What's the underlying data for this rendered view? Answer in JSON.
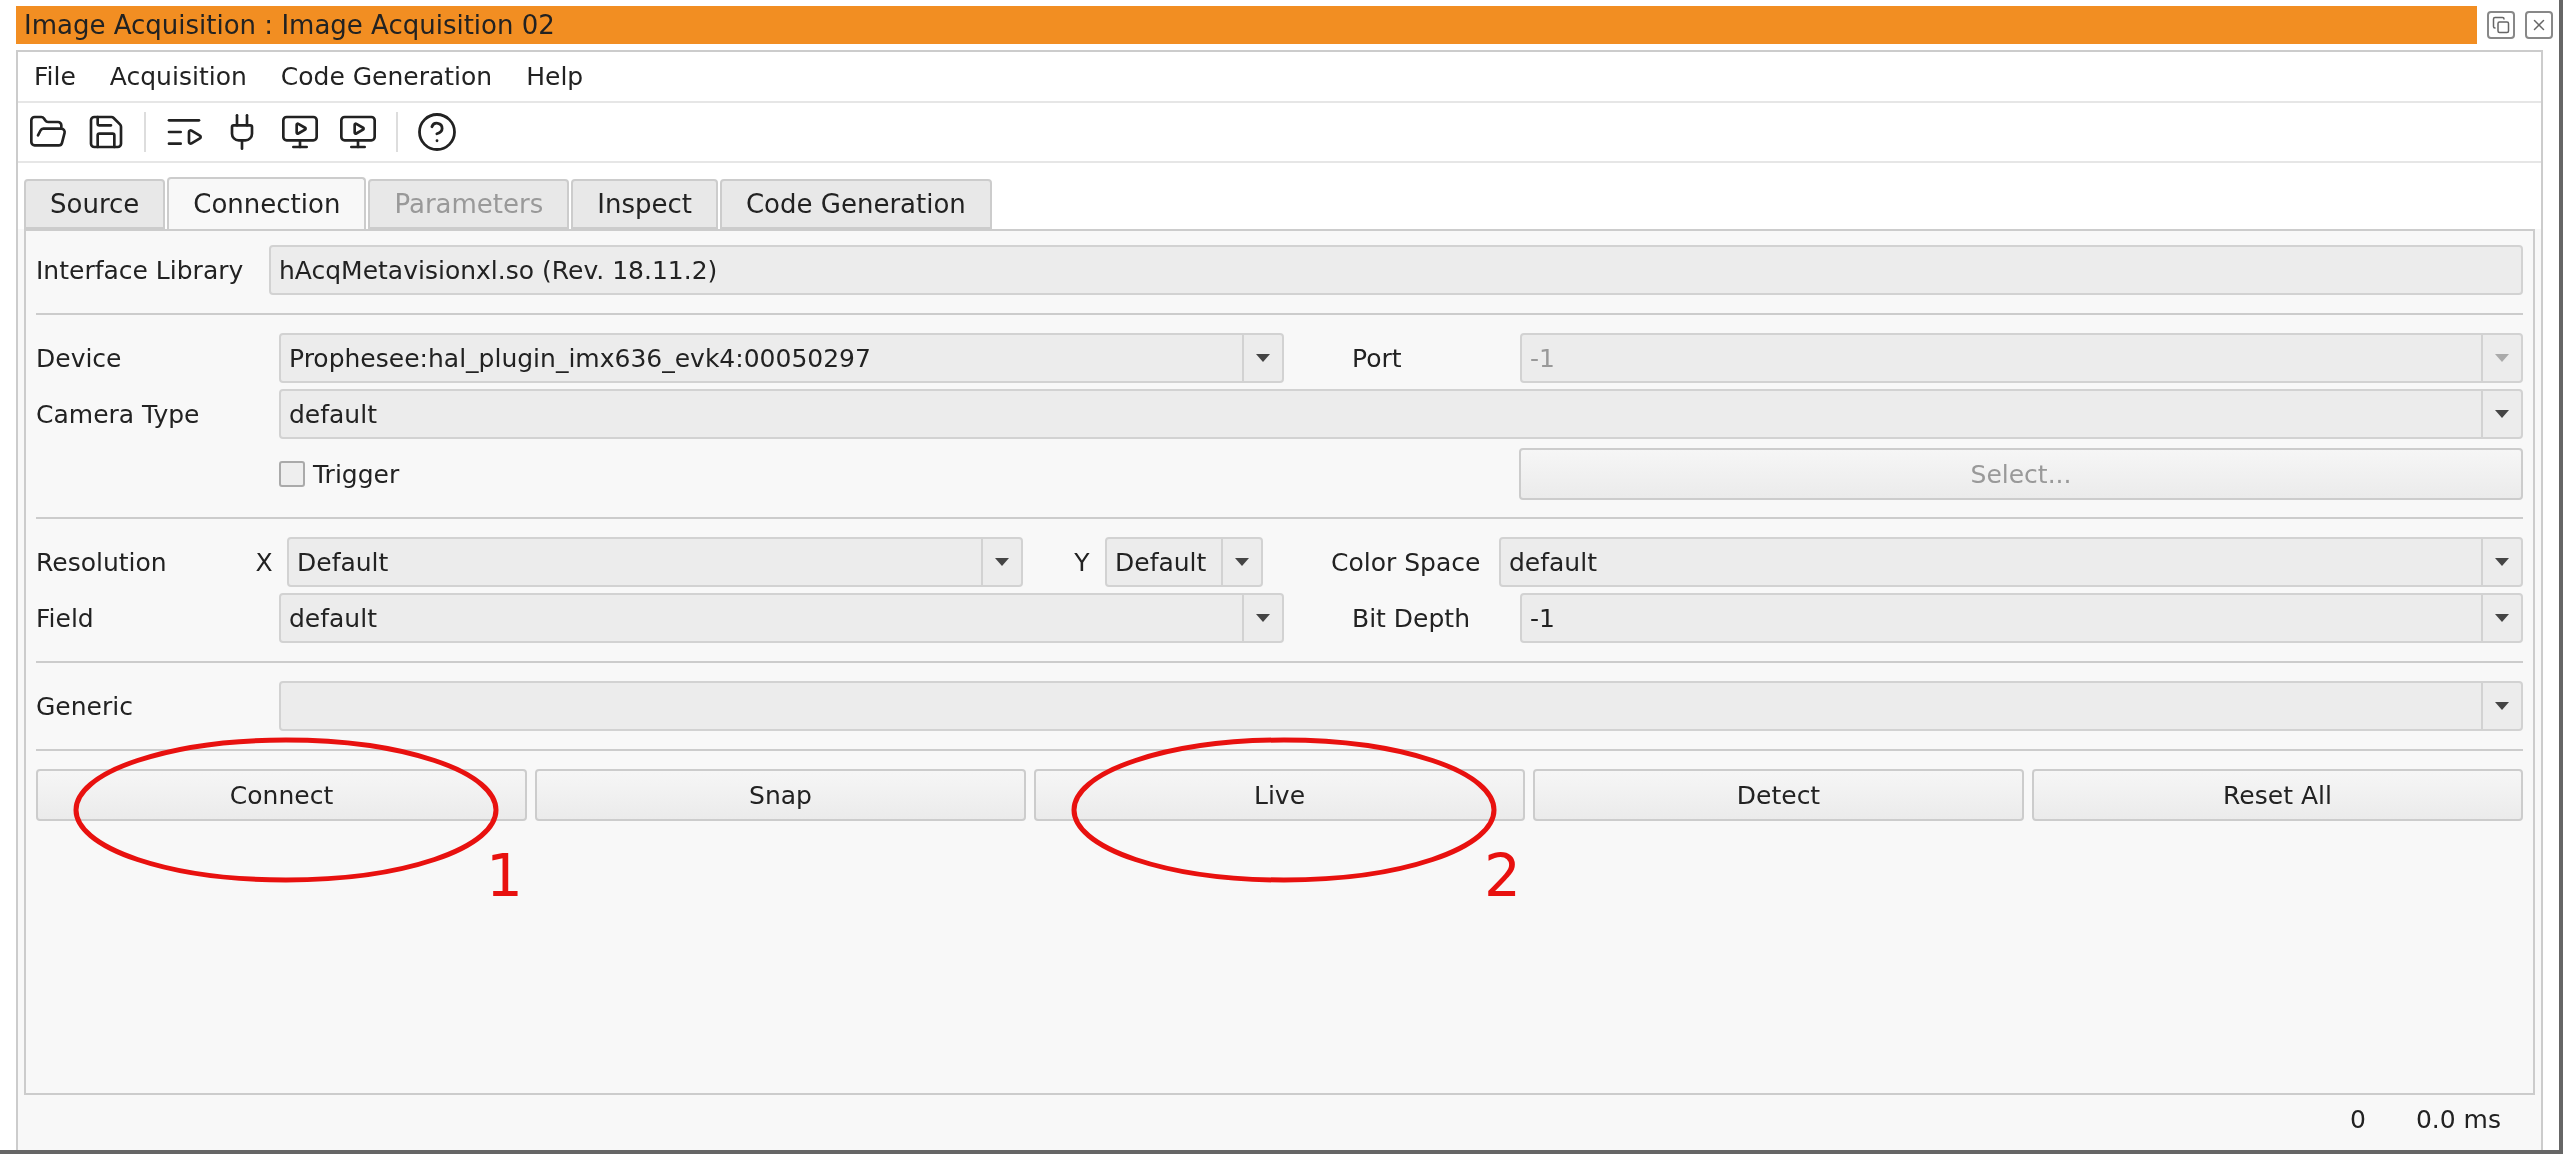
{
  "window": {
    "title": "Image Acquisition : Image Acquisition 02"
  },
  "menu": [
    "File",
    "Acquisition",
    "Code Generation",
    "Help"
  ],
  "tabs": [
    {
      "label": "Source",
      "selected": false,
      "disabled": false
    },
    {
      "label": "Connection",
      "selected": true,
      "disabled": false
    },
    {
      "label": "Parameters",
      "selected": false,
      "disabled": true
    },
    {
      "label": "Inspect",
      "selected": false,
      "disabled": false
    },
    {
      "label": "Code Generation",
      "selected": false,
      "disabled": false
    }
  ],
  "interface_library": {
    "label": "Interface Library",
    "value": "hAcqMetavisionxl.so (Rev. 18.11.2)"
  },
  "device": {
    "label": "Device",
    "value": "Prophesee:hal_plugin_imx636_evk4:00050297"
  },
  "port": {
    "label": "Port",
    "value": "-1",
    "disabled": true
  },
  "camera_type": {
    "label": "Camera Type",
    "value": "default"
  },
  "trigger": {
    "label": "Trigger",
    "checked": false
  },
  "select_button": {
    "label": "Select...",
    "disabled": true
  },
  "resolution": {
    "label": "Resolution",
    "x_label": "X",
    "x_value": "Default",
    "y_label": "Y",
    "y_value": "Default"
  },
  "color_space": {
    "label": "Color Space",
    "value": "default"
  },
  "field": {
    "label": "Field",
    "value": "default"
  },
  "bit_depth": {
    "label": "Bit Depth",
    "value": "-1"
  },
  "generic": {
    "label": "Generic"
  },
  "buttons": [
    {
      "label": "Connect",
      "annotation": "1"
    },
    {
      "label": "Snap"
    },
    {
      "label": "Live",
      "annotation": "2"
    },
    {
      "label": "Detect"
    },
    {
      "label": "Reset All"
    }
  ],
  "status": [
    "0",
    "0.0 ms"
  ]
}
